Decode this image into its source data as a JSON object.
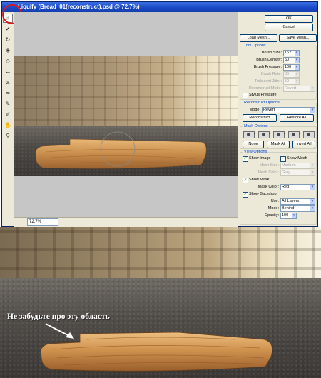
{
  "window": {
    "title": "Liquify (Bread_01(reconstruct).psd @ 72.7%)",
    "zoom": "72.7%"
  },
  "tools": [
    {
      "icon": "forward-warp-icon"
    },
    {
      "icon": "reconstruct-icon"
    },
    {
      "icon": "twirl-icon"
    },
    {
      "icon": "pucker-icon"
    },
    {
      "icon": "bloat-icon"
    },
    {
      "icon": "push-left-icon"
    },
    {
      "icon": "mirror-icon"
    },
    {
      "icon": "turbulence-icon"
    },
    {
      "icon": "freeze-mask-icon"
    },
    {
      "icon": "thaw-mask-icon"
    },
    {
      "icon": "hand-icon"
    },
    {
      "icon": "zoom-icon"
    }
  ],
  "buttons": {
    "ok": "OK",
    "cancel": "Cancel",
    "load_mesh": "Load Mesh...",
    "save_mesh": "Save Mesh..."
  },
  "tool_options": {
    "title": "Tool Options",
    "brush_size_label": "Brush Size:",
    "brush_size": "162",
    "brush_density_label": "Brush Density:",
    "brush_density": "50",
    "brush_pressure_label": "Brush Pressure:",
    "brush_pressure": "100",
    "brush_rate_label": "Brush Rate:",
    "brush_rate": "80",
    "turbulent_jitter_label": "Turbulent Jitter:",
    "turbulent_jitter": "50",
    "reconstruct_mode_label": "Reconstruct Mode:",
    "reconstruct_mode": "Revert",
    "stylus_pressure_label": "Stylus Pressure",
    "stylus_pressure_checked": false
  },
  "reconstruct_options": {
    "title": "Reconstruct Options",
    "mode_label": "Mode:",
    "mode": "Revert",
    "reconstruct": "Reconstruct",
    "restore_all": "Restore All"
  },
  "mask_options": {
    "title": "Mask Options",
    "none": "None",
    "mask_all": "Mask All",
    "invert_all": "Invert All"
  },
  "view_options": {
    "title": "View Options",
    "show_image_label": "Show Image",
    "show_image_checked": true,
    "show_mesh_label": "Show Mesh",
    "show_mesh_checked": false,
    "mesh_size_label": "Mesh Size:",
    "mesh_size": "Medium",
    "mesh_color_label": "Mesh Color:",
    "mesh_color": "Gray",
    "show_mask_label": "Show Mask",
    "show_mask_checked": true,
    "mask_color_label": "Mask Color:",
    "mask_color": "Red",
    "show_backdrop_label": "Show Backdrop",
    "show_backdrop_checked": true,
    "use_label": "Use:",
    "use": "All Layers",
    "mode_label": "Mode:",
    "mode": "Behind",
    "opacity_label": "Opacity:",
    "opacity": "100"
  },
  "annotation": "Не забудьте про эту область",
  "colors": {
    "highlight_circle": "#e0151c",
    "title_bar": "#1947c3",
    "panel_bg": "#ece9d8"
  }
}
